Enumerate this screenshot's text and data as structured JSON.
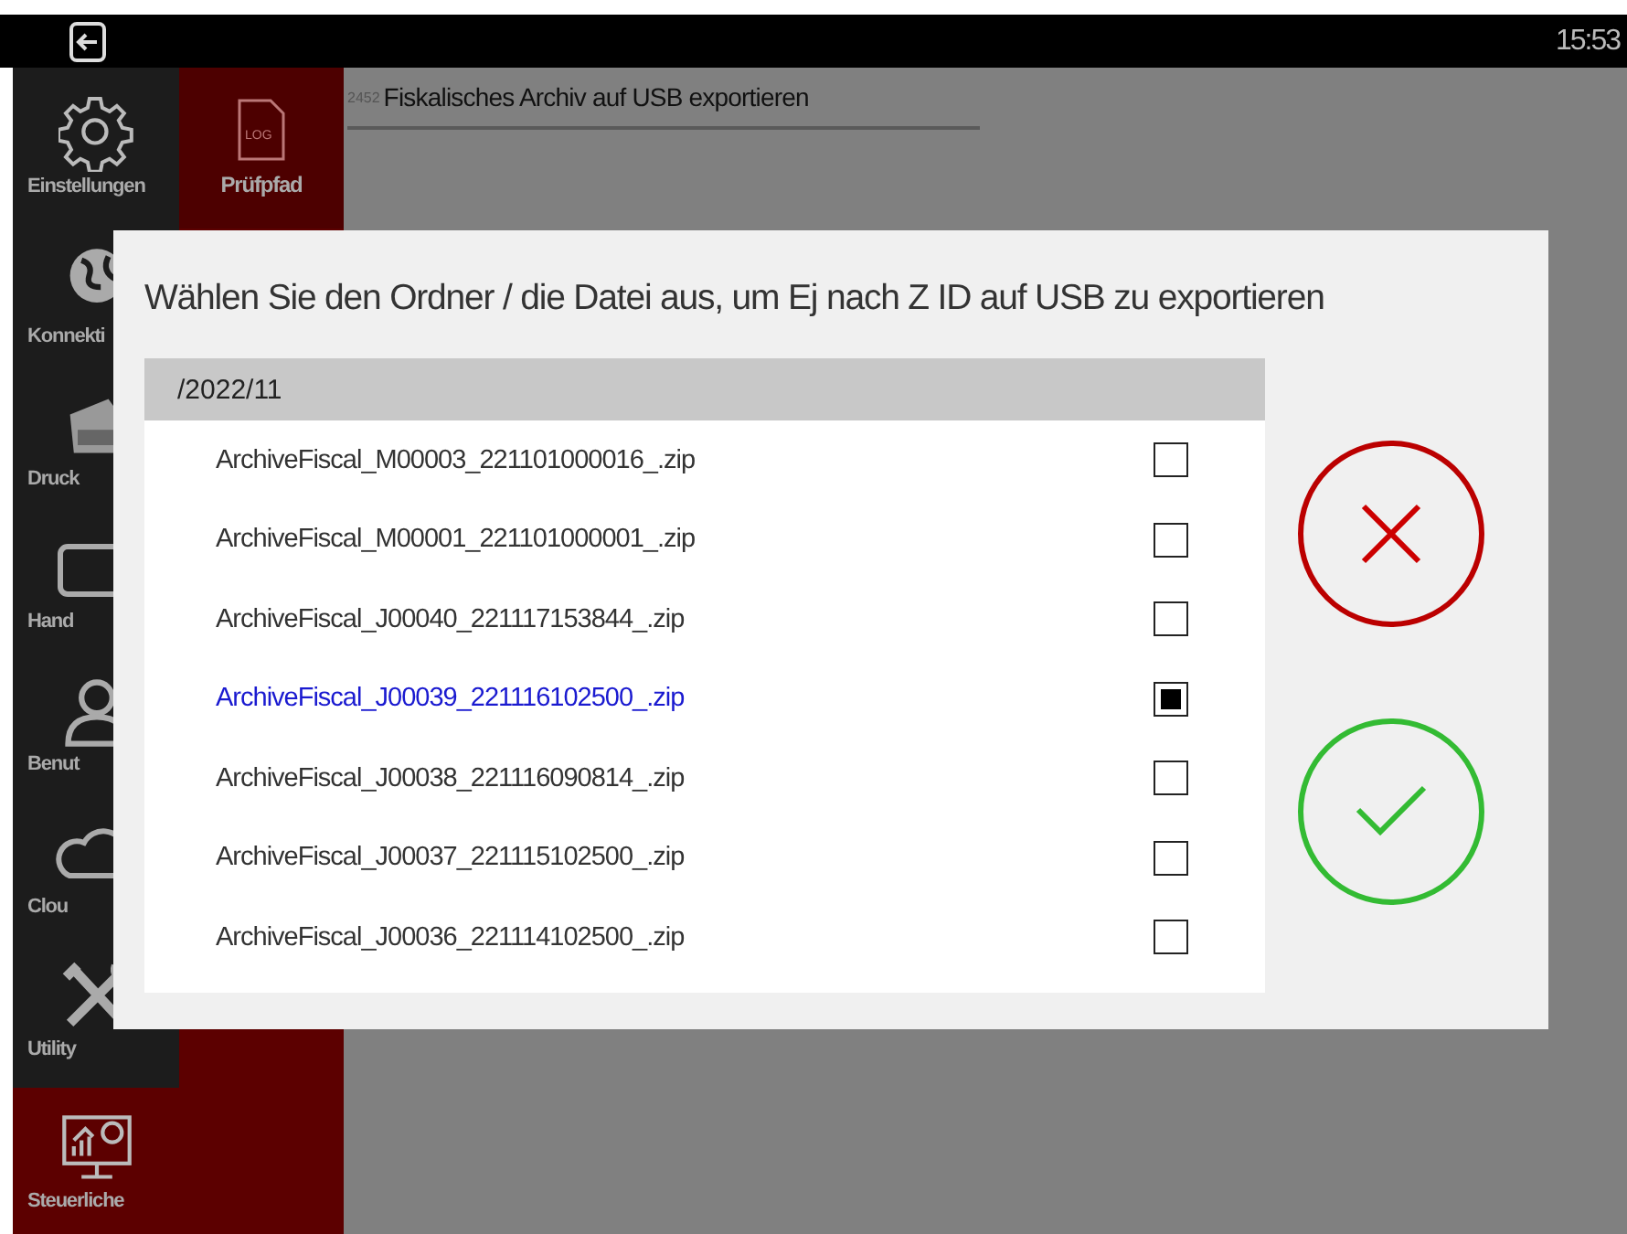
{
  "top_bar": {
    "time": "15:53"
  },
  "sidebar": {
    "items": [
      {
        "label": "Einstellungen",
        "selected": false
      },
      {
        "label": "Konnekti",
        "selected": false
      },
      {
        "label": "Druck",
        "selected": false
      },
      {
        "label": "Hand",
        "selected": false
      },
      {
        "label": "Benut",
        "selected": false
      },
      {
        "label": "Clou",
        "selected": false
      },
      {
        "label": "Utility",
        "selected": false
      },
      {
        "label": "Steuerliche",
        "selected": true
      }
    ]
  },
  "subnav": {
    "items": [
      {
        "label": "Prüfpfad",
        "icon_text": "LOG",
        "selected": true
      }
    ]
  },
  "header": {
    "code": "2452",
    "title": "Fiskalisches Archiv auf USB exportieren"
  },
  "dialog": {
    "title": "Wählen Sie den Ordner / die Datei aus, um Ej nach Z ID auf USB zu exportieren",
    "folder": "/2022/11",
    "files": [
      {
        "name": "ArchiveFiscal_M00003_221101000016_.zip",
        "checked": false
      },
      {
        "name": "ArchiveFiscal_M00001_221101000001_.zip",
        "checked": false
      },
      {
        "name": "ArchiveFiscal_J00040_221117153844_.zip",
        "checked": false
      },
      {
        "name": "ArchiveFiscal_J00039_221116102500_.zip",
        "checked": true
      },
      {
        "name": "ArchiveFiscal_J00038_221116090814_.zip",
        "checked": false
      },
      {
        "name": "ArchiveFiscal_J00037_221115102500_.zip",
        "checked": false
      },
      {
        "name": "ArchiveFiscal_J00036_221114102500_.zip",
        "checked": false
      }
    ]
  }
}
